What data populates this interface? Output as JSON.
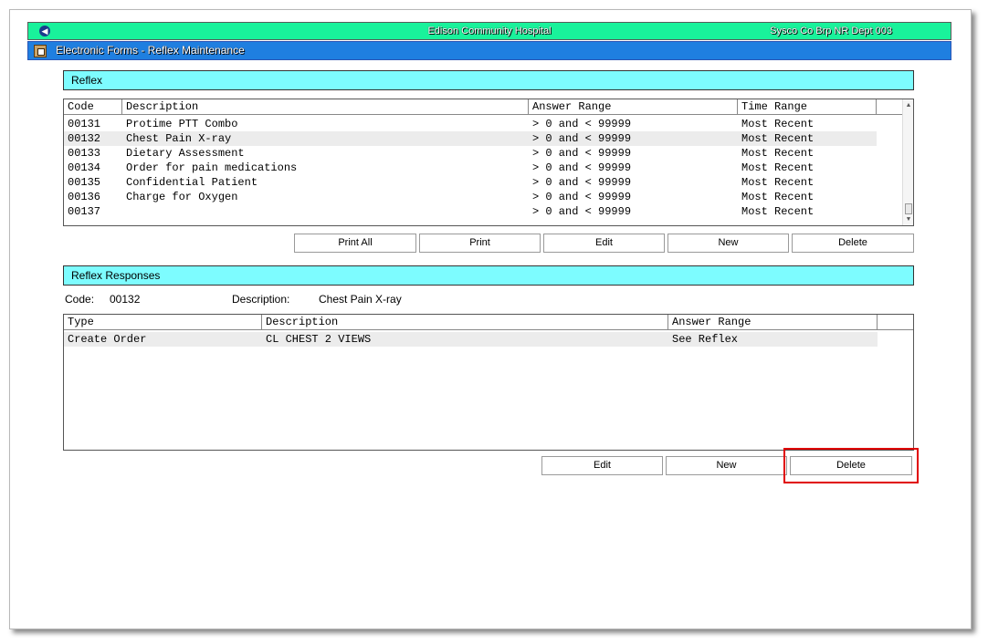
{
  "titlebar": {
    "hospital": "Edison Community Hospital",
    "user_info": "Sysco Co Brp NR  Dept 003"
  },
  "formbar": {
    "title": "Electronic Forms - Reflex Maintenance"
  },
  "reflex": {
    "header": "Reflex",
    "columns": [
      "Code",
      "Description",
      "Answer Range",
      "Time Range"
    ],
    "rows": [
      {
        "code": "00131",
        "description": "Protime PTT Combo",
        "answer_range": "> 0 and < 99999",
        "time_range": "Most Recent"
      },
      {
        "code": "00132",
        "description": "Chest Pain X-ray",
        "answer_range": "> 0 and < 99999",
        "time_range": "Most Recent"
      },
      {
        "code": "00133",
        "description": "Dietary Assessment",
        "answer_range": "> 0 and < 99999",
        "time_range": "Most Recent"
      },
      {
        "code": "00134",
        "description": "Order for pain medications",
        "answer_range": "> 0 and < 99999",
        "time_range": "Most Recent"
      },
      {
        "code": "00135",
        "description": "Confidential Patient",
        "answer_range": "> 0 and < 99999",
        "time_range": "Most Recent"
      },
      {
        "code": "00136",
        "description": "Charge for Oxygen",
        "answer_range": "> 0 and < 99999",
        "time_range": "Most Recent"
      },
      {
        "code": "00137",
        "description": "",
        "answer_range": "> 0 and < 99999",
        "time_range": "Most Recent"
      }
    ],
    "selected_row": 1,
    "buttons": {
      "print_all": "Print All",
      "print": "Print",
      "edit": "Edit",
      "new": "New",
      "delete": "Delete"
    }
  },
  "responses": {
    "header": "Reflex Responses",
    "code_label": "Code:",
    "code_value": "00132",
    "description_label": "Description:",
    "description_value": "Chest Pain X-ray",
    "columns": [
      "Type",
      "Description",
      "Answer Range"
    ],
    "rows": [
      {
        "type": "Create Order",
        "description": "CL CHEST 2 VIEWS",
        "answer_range": "See Reflex"
      }
    ],
    "buttons": {
      "edit": "Edit",
      "new": "New",
      "delete": "Delete"
    }
  },
  "colors": {
    "titlebar": "#19f29b",
    "formbar": "#1f7fe0",
    "section_header": "#7dfcff",
    "highlight": "#e00000"
  }
}
